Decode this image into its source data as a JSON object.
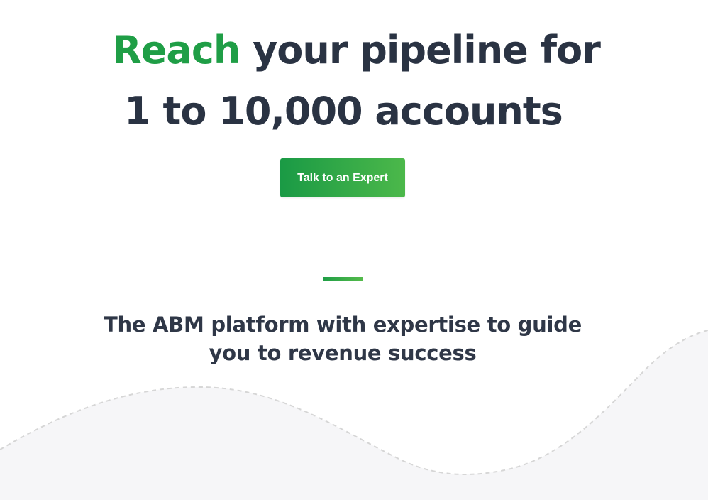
{
  "hero": {
    "headline_accent": "Reach",
    "headline_rest": "your pipeline for",
    "headline_line2": "1 to 10,000 accounts",
    "cta_label": "Talk to an Expert"
  },
  "section": {
    "subheading_line1": "The ABM platform with expertise to guide",
    "subheading_line2": "you to revenue success"
  },
  "colors": {
    "accent": "#1f9e46",
    "headline_text": "#2a3343",
    "button_gradient_start": "#1a9a45",
    "button_gradient_end": "#4cb84a",
    "wave_fill": "#f6f6f8",
    "wave_dash": "#d6d6d6"
  }
}
